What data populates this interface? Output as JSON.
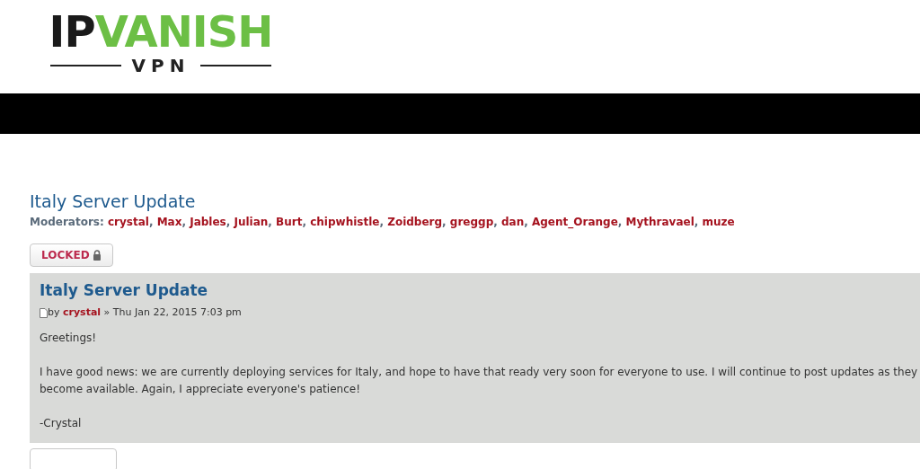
{
  "logo": {
    "part_1": "IP",
    "part_2": "VANISH",
    "subtitle": "VPN"
  },
  "forum": {
    "title": "Italy Server Update",
    "moderators_label": "Moderators:",
    "moderator_separator": ",",
    "moderators": [
      "crystal",
      "Max",
      "Jables",
      "Julian",
      "Burt",
      "chipwhistle",
      "Zoidberg",
      "greggp",
      "dan",
      "Agent_Orange",
      "Mythravael",
      "muze"
    ]
  },
  "locked_button": {
    "label": "LOCKED"
  },
  "post": {
    "title": "Italy Server Update",
    "by": "by",
    "author": "crystal",
    "separator": "»",
    "date": "Thu Jan 22, 2015 7:03 pm",
    "paragraphs": [
      "Greetings!",
      "I have good news: we are currently deploying services for Italy, and hope to have that ready very soon for everyone to use. I will continue to post updates as they become available. Again, I appreciate everyone's patience!",
      "-Crystal"
    ]
  }
}
